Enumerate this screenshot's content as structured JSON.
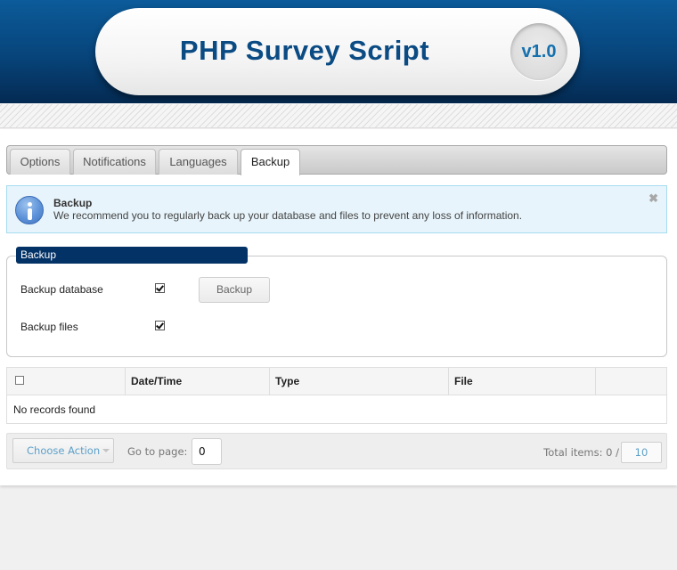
{
  "header": {
    "title": "PHP Survey Script",
    "version": "v1.0"
  },
  "tabs": [
    {
      "label": "Options",
      "active": false
    },
    {
      "label": "Notifications",
      "active": false
    },
    {
      "label": "Languages",
      "active": false
    },
    {
      "label": "Backup",
      "active": true
    }
  ],
  "notice": {
    "icon": "info-icon",
    "title": "Backup",
    "text": "We recommend you to regularly back up your database and files to prevent any loss of information.",
    "close_glyph": "✖"
  },
  "backup_form": {
    "legend": "Backup",
    "options": [
      {
        "label": "Backup database",
        "checked": true
      },
      {
        "label": "Backup files",
        "checked": true
      }
    ],
    "button_label": "Backup"
  },
  "table": {
    "columns": [
      "",
      "Date/Time",
      "Type",
      "File",
      ""
    ],
    "empty_message": "No records found"
  },
  "pager": {
    "action_label": "Choose Action",
    "goto_label": "Go to page:",
    "page_value": "0",
    "total_label": "Total items: 0 /",
    "per_page": "10"
  },
  "colors": {
    "header_blue": "#07447a",
    "title_blue": "#0b4b84",
    "legend_bg": "#033266",
    "notice_bg": "#e7f4fb",
    "link_blue": "#5da0c9"
  }
}
